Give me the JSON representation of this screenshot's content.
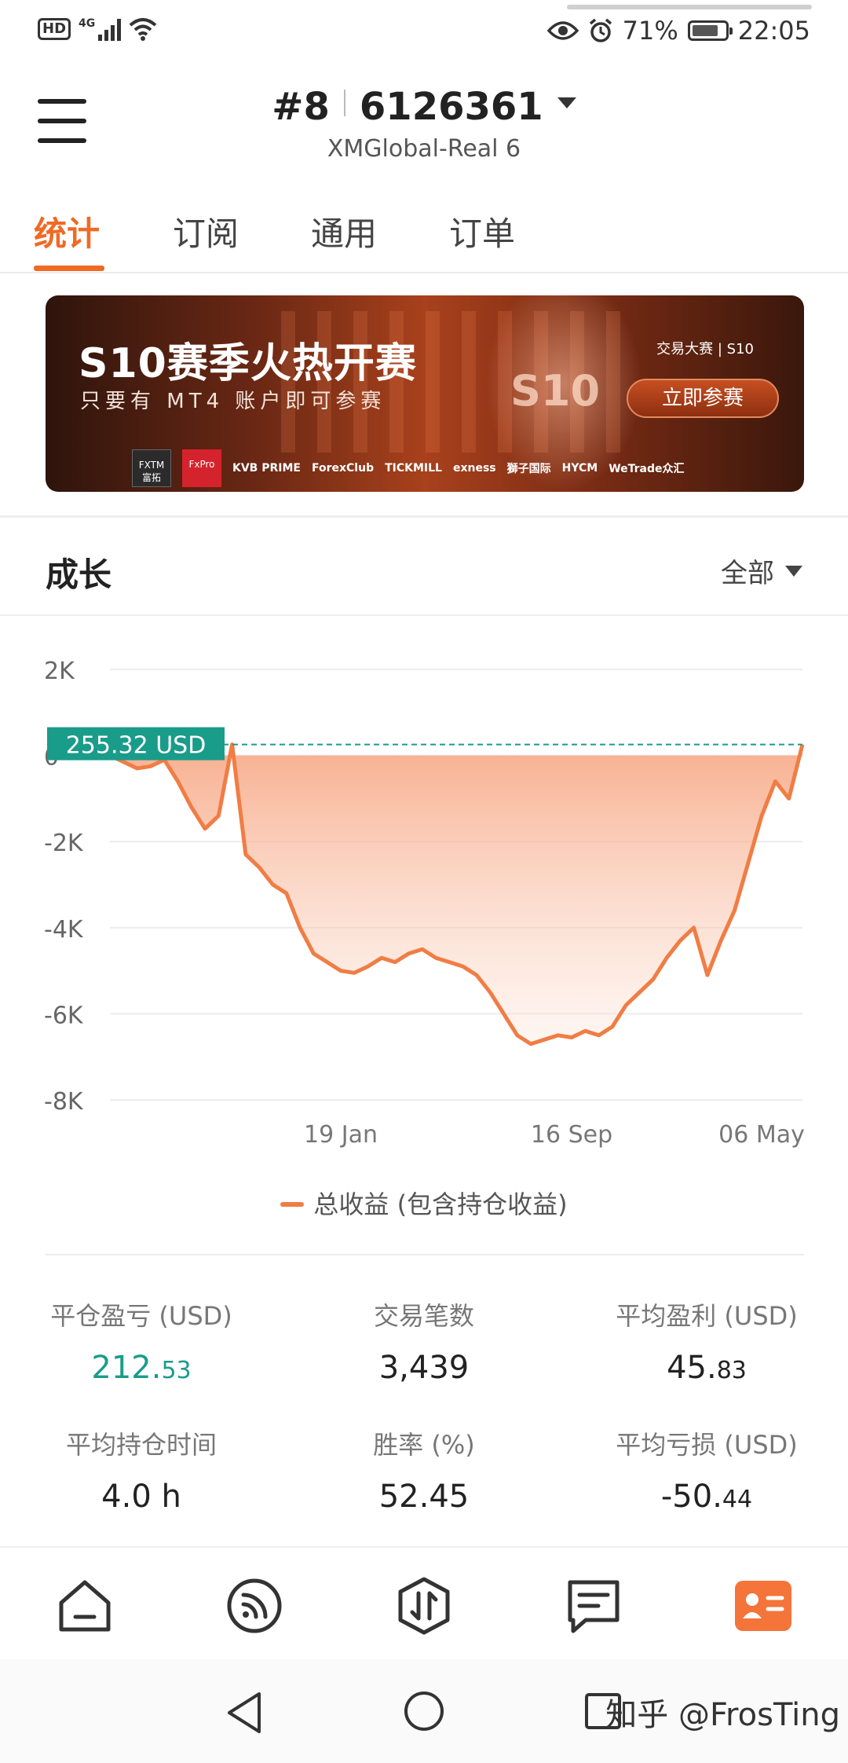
{
  "status_bar": {
    "hd": "HD",
    "network": "4G",
    "battery_percent": "71%",
    "battery_level": 0.71,
    "time": "22:05"
  },
  "header": {
    "rank": "#8",
    "account_id": "6126361",
    "server": "XMGlobal-Real 6"
  },
  "tabs": [
    {
      "label": "统计",
      "active": true
    },
    {
      "label": "订阅",
      "active": false
    },
    {
      "label": "通用",
      "active": false
    },
    {
      "label": "订单",
      "active": false
    }
  ],
  "banner": {
    "title": "S10赛季火热开赛",
    "subtitle": "只要有 MT4 账户即可参赛",
    "tag": "交易大赛 | S10",
    "season": "S10",
    "cta": "立即参赛",
    "brand_logos": [
      "FXTM 富拓",
      "FxPro",
      "KVB PRIME",
      "ForexClub",
      "TICKMILL",
      "exness",
      "獅子国际",
      "HYCM",
      "WeTrade众汇"
    ]
  },
  "growth": {
    "title": "成长",
    "filter": "全部"
  },
  "chart_data": {
    "type": "area",
    "title": "",
    "y_ticks": [
      "2K",
      "0",
      "-2K",
      "-4K",
      "-6K",
      "-8K"
    ],
    "x_ticks": [
      "19 Jan",
      "16 Sep",
      "06 May"
    ],
    "ylim": [
      -8000,
      2000
    ],
    "current_label": "255.32 USD",
    "current_value": 255.32,
    "series": [
      {
        "name": "总收益 (包含持仓收益)",
        "color": "#f07d45",
        "y": [
          0,
          -150,
          -300,
          -250,
          -100,
          -600,
          -1200,
          -1700,
          -1400,
          255,
          -2300,
          -2600,
          -3000,
          -3200,
          -4000,
          -4600,
          -4800,
          -5000,
          -5050,
          -4900,
          -4700,
          -4800,
          -4600,
          -4500,
          -4700,
          -4800,
          -4900,
          -5100,
          -5500,
          -6000,
          -6500,
          -6700,
          -6600,
          -6500,
          -6550,
          -6400,
          -6500,
          -6300,
          -5800,
          -5500,
          -5200,
          -4700,
          -4300,
          -4000,
          -5100,
          -4300,
          -3600,
          -2500,
          -1400,
          -600,
          -1000,
          255
        ]
      }
    ]
  },
  "stats": [
    {
      "label": "平仓盈亏 (USD)",
      "int": "212.",
      "dec": "53",
      "highlight": true
    },
    {
      "label": "交易笔数",
      "int": "3,439",
      "dec": "",
      "highlight": false
    },
    {
      "label": "平均盈利 (USD)",
      "int": "45.",
      "dec": "83",
      "highlight": false
    },
    {
      "label": "平均持仓时间",
      "int": "4.0 h",
      "dec": "",
      "highlight": false
    },
    {
      "label": "胜率 (%)",
      "int": "52.45",
      "dec": "",
      "highlight": false
    },
    {
      "label": "平均亏损 (USD)",
      "int": "-50.",
      "dec": "44",
      "highlight": false
    }
  ],
  "watermark": "知乎 @FrosTing",
  "colors": {
    "accent": "#ef6a25",
    "positive": "#1a9c8a",
    "chart_line": "#f07d45"
  }
}
